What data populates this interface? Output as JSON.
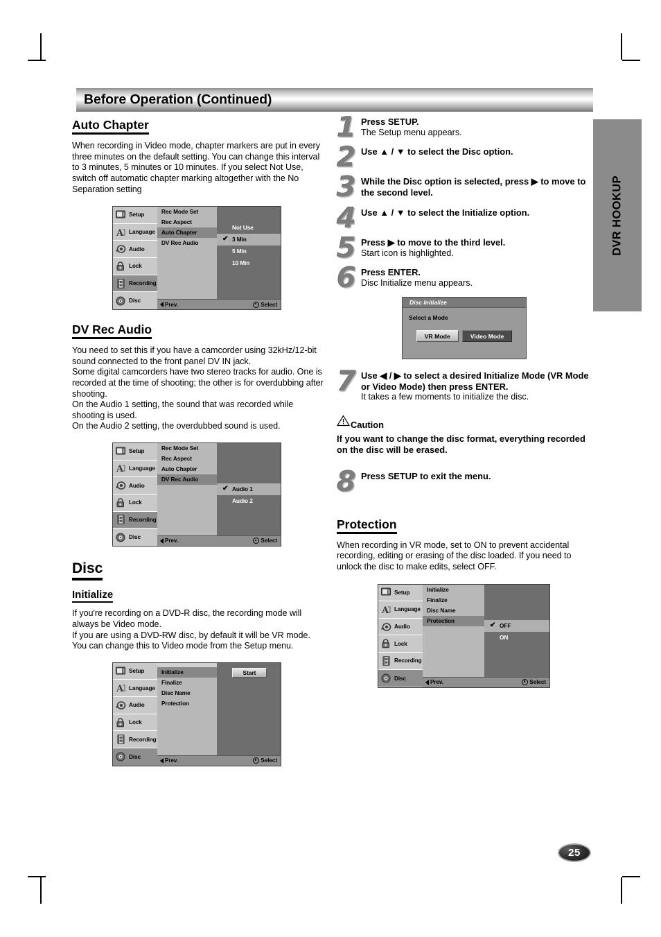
{
  "header": {
    "title": "Before Operation (Continued)"
  },
  "side_tab": {
    "label": "DVR HOOKUP"
  },
  "page_number": "25",
  "left_column": {
    "auto_chapter": {
      "heading": "Auto Chapter",
      "body": "When recording in Video mode, chapter markers are put in every three minutes on the default setting. You can change this interval to 3 minutes, 5 minutes or 10 minutes. If you select Not Use, switch off automatic chapter marking altogether with the No Separation setting"
    },
    "dv_rec_audio": {
      "heading": "DV Rec Audio",
      "body": "You need to set this if you have a camcorder using 32kHz/12-bit sound connected to the front panel DV IN jack.\nSome digital camcorders have two stereo tracks for audio. One is recorded at the time of shooting; the other is for overdubbing after shooting.\nOn the Audio 1 setting, the sound that was recorded while shooting is used.\nOn the Audio 2 setting, the overdubbed sound is used."
    },
    "disc": {
      "heading": "Disc"
    },
    "initialize": {
      "heading": "Initialize",
      "body": "If you're recording on a DVD-R disc, the recording mode will always be Video mode.\nIf you are using a DVD-RW disc, by default it will be VR mode. You can change this to Video mode from the Setup menu."
    }
  },
  "right_column": {
    "steps": [
      {
        "num": "1",
        "bold": "Press SETUP.",
        "reg": "The Setup menu appears."
      },
      {
        "num": "2",
        "bold": "Use ▲ / ▼ to select the Disc option.",
        "reg": ""
      },
      {
        "num": "3",
        "bold": "While the Disc option is selected, press ▶ to move to the second level.",
        "reg": ""
      },
      {
        "num": "4",
        "bold": "Use ▲ / ▼ to select the Initialize option.",
        "reg": ""
      },
      {
        "num": "5",
        "bold": "Press ▶ to move to the third level.",
        "reg": "Start icon is highlighted."
      },
      {
        "num": "6",
        "bold": "Press ENTER.",
        "reg": "Disc Initialize menu appears."
      }
    ],
    "step7": {
      "num": "7",
      "bold": "Use ◀ / ▶ to select a desired Initialize Mode (VR Mode or Video Mode) then press ENTER.",
      "reg": "It takes a few moments to initialize the disc."
    },
    "caution": {
      "title": "Caution",
      "body": "If you want to change the disc format, everything recorded on the disc will be erased."
    },
    "step8": {
      "num": "8",
      "bold": "Press SETUP to exit the menu.",
      "reg": ""
    },
    "protection": {
      "heading": "Protection",
      "body": "When recording in VR mode, set to ON to prevent accidental recording, editing or erasing of the disc loaded. If you need to unlock the disc to make edits, select OFF."
    }
  },
  "osd": {
    "sidebar": [
      {
        "label": "Setup",
        "icon": "tv-icon"
      },
      {
        "label": "Language",
        "icon": "letter-a-icon"
      },
      {
        "label": "Audio",
        "icon": "speaker-icon"
      },
      {
        "label": "Lock",
        "icon": "padlock-icon"
      },
      {
        "label": "Recording",
        "icon": "film-strip-icon"
      },
      {
        "label": "Disc",
        "icon": "disc-icon"
      }
    ],
    "footer": {
      "prev": "Prev.",
      "select": "Select"
    },
    "recording_menu_items": [
      "Rec Mode Set",
      "Rec Aspect",
      "Auto Chapter",
      "DV Rec Audio"
    ],
    "disc_menu_items": [
      "Initialize",
      "Finalize",
      "Disc Name",
      "Protection"
    ]
  },
  "screens": {
    "auto_chapter": {
      "selected_sidebar": "Recording",
      "selected_menu": "Auto Chapter",
      "options": [
        {
          "label": "Not Use",
          "checked": false,
          "highlighted": false
        },
        {
          "label": "3 Min",
          "checked": true,
          "highlighted": true
        },
        {
          "label": "5 Min",
          "checked": false,
          "highlighted": false
        },
        {
          "label": "10 Min",
          "checked": false,
          "highlighted": false
        }
      ]
    },
    "dv_rec_audio": {
      "selected_sidebar": "Recording",
      "selected_menu": "DV Rec Audio",
      "options": [
        {
          "label": "Audio 1",
          "checked": true,
          "highlighted": true
        },
        {
          "label": "Audio 2",
          "checked": false,
          "highlighted": false
        }
      ]
    },
    "initialize": {
      "selected_sidebar": "Disc",
      "selected_menu": "Initialize",
      "start_button": "Start"
    },
    "protection": {
      "selected_sidebar": "Disc",
      "selected_menu": "Protection",
      "options": [
        {
          "label": "OFF",
          "checked": true,
          "highlighted": true
        },
        {
          "label": "ON",
          "checked": false,
          "highlighted": false
        }
      ]
    }
  },
  "dialog": {
    "title": "Disc Initialize",
    "label": "Select a Mode",
    "buttons": [
      {
        "label": "VR Mode",
        "selected": false
      },
      {
        "label": "Video Mode",
        "selected": true
      }
    ]
  }
}
